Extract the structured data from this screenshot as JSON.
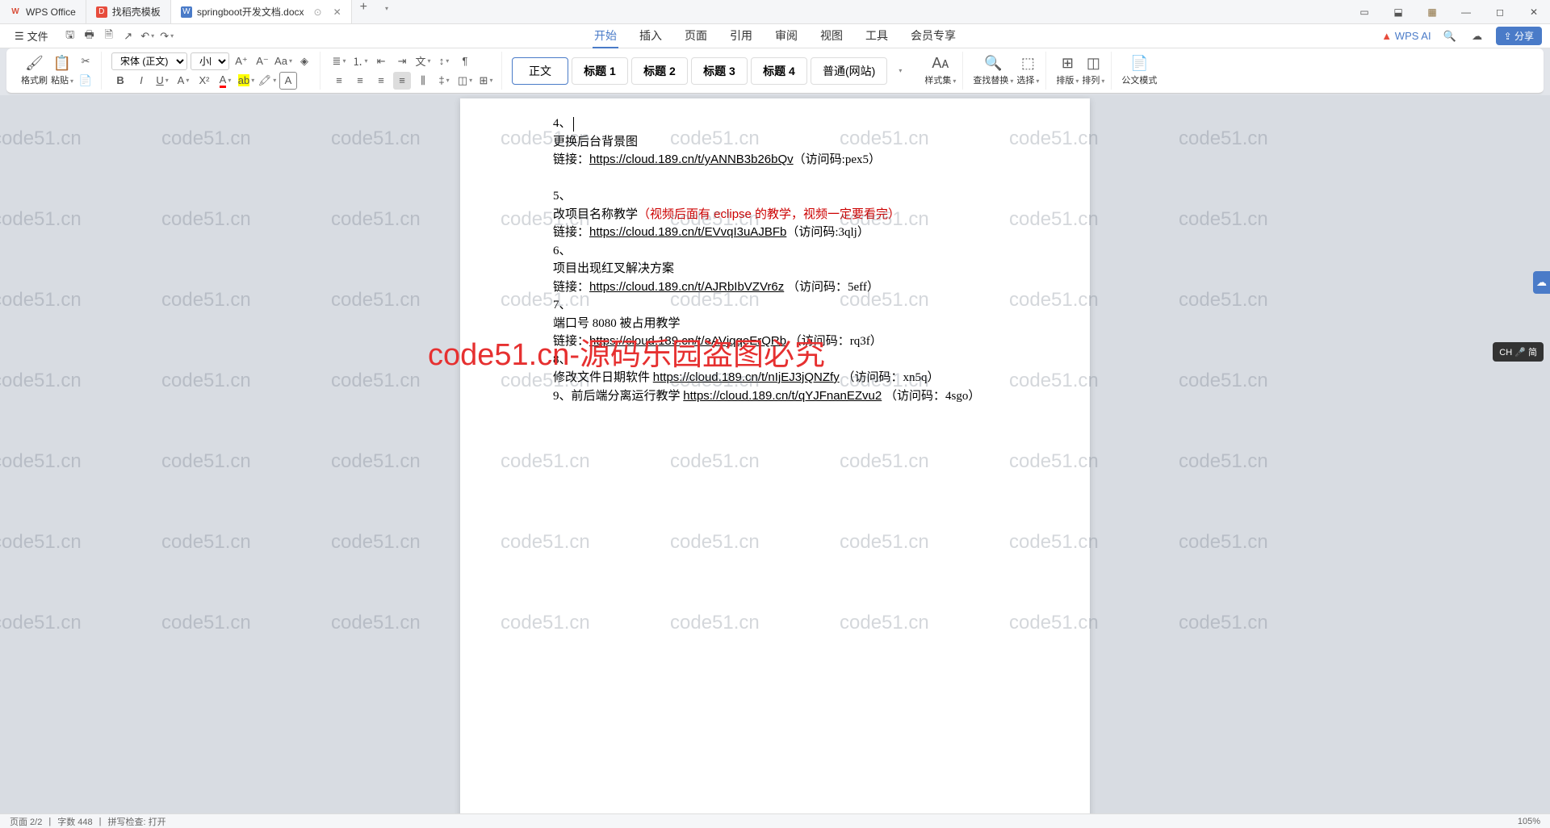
{
  "titlebar": {
    "tabs": [
      {
        "icon": "W",
        "label": "WPS Office"
      },
      {
        "icon": "D",
        "label": "找稻壳模板"
      },
      {
        "icon": "W",
        "label": "springboot开发文档.docx"
      }
    ],
    "win_icons": [
      "▭",
      "⬓",
      "▦",
      "—",
      "◻",
      "✕"
    ]
  },
  "menubar": {
    "file": "文件",
    "tabs": [
      "开始",
      "插入",
      "页面",
      "引用",
      "审阅",
      "视图",
      "工具",
      "会员专享"
    ],
    "wps_ai": "WPS AI",
    "share": "分享"
  },
  "ribbon": {
    "format_brush": "格式刷",
    "paste": "粘贴",
    "font_name": "宋体 (正文)",
    "font_size": "小四",
    "styles": {
      "body": "正文",
      "h1": "标题 1",
      "h2": "标题 2",
      "h3": "标题 3",
      "h4": "标题 4",
      "normal_web": "普通(网站)"
    },
    "style_set": "样式集",
    "find_replace": "查找替换",
    "select": "选择",
    "layout": "排版",
    "arrange": "排列",
    "gov_mode": "公文模式"
  },
  "document": {
    "lines": [
      {
        "type": "num",
        "text": "4、"
      },
      {
        "type": "text",
        "text": "更换后台背景图"
      },
      {
        "type": "link",
        "prefix": "链接：",
        "url": "https://cloud.189.cn/t/yANNB3b26bQv",
        "suffix": "（访问码:pex5）"
      },
      {
        "type": "blank",
        "text": ""
      },
      {
        "type": "num",
        "text": "5、"
      },
      {
        "type": "mixed",
        "text": "改项目名称教学",
        "red": "（视频后面有 eclipse 的教学，视频一定要看完）"
      },
      {
        "type": "link",
        "prefix": "链接：",
        "url": "https://cloud.189.cn/t/EVvqI3uAJBFb",
        "suffix": "（访问码:3qlj）"
      },
      {
        "type": "num",
        "text": "6、"
      },
      {
        "type": "text",
        "text": "项目出现红叉解决方案"
      },
      {
        "type": "link",
        "prefix": "链接：",
        "url": "https://cloud.189.cn/t/AJRbIbVZVr6z",
        "suffix": "  （访问码：5eff）"
      },
      {
        "type": "num",
        "text": "7、"
      },
      {
        "type": "text",
        "text": "端口号 8080 被占用教学"
      },
      {
        "type": "link",
        "prefix": "链接：",
        "url": "https://cloud.189.cn/t/eAVjqqeErQRb",
        "suffix": " （访问码：rq3f）"
      },
      {
        "type": "num",
        "text": "8、"
      },
      {
        "type": "link",
        "prefix": "修改文件日期软件 ",
        "url": "https://cloud.189.cn/t/nIjEJ3jQNZfy",
        "suffix": "  （访问码：xn5q）"
      },
      {
        "type": "link",
        "prefix": "9、前后端分离运行教学 ",
        "url": "https://cloud.189.cn/t/qYJFnanEZvu2",
        "suffix": " （访问码：4sgo）"
      }
    ]
  },
  "watermark_text": "code51.cn",
  "big_watermark": "code51.cn-源码乐园盗图必究",
  "ime": "CH 🎤 简",
  "statusbar": {
    "page": "页面 2/2",
    "words": "字数 448",
    "spell": "拼写检查: 打开",
    "zoom": "105%"
  }
}
